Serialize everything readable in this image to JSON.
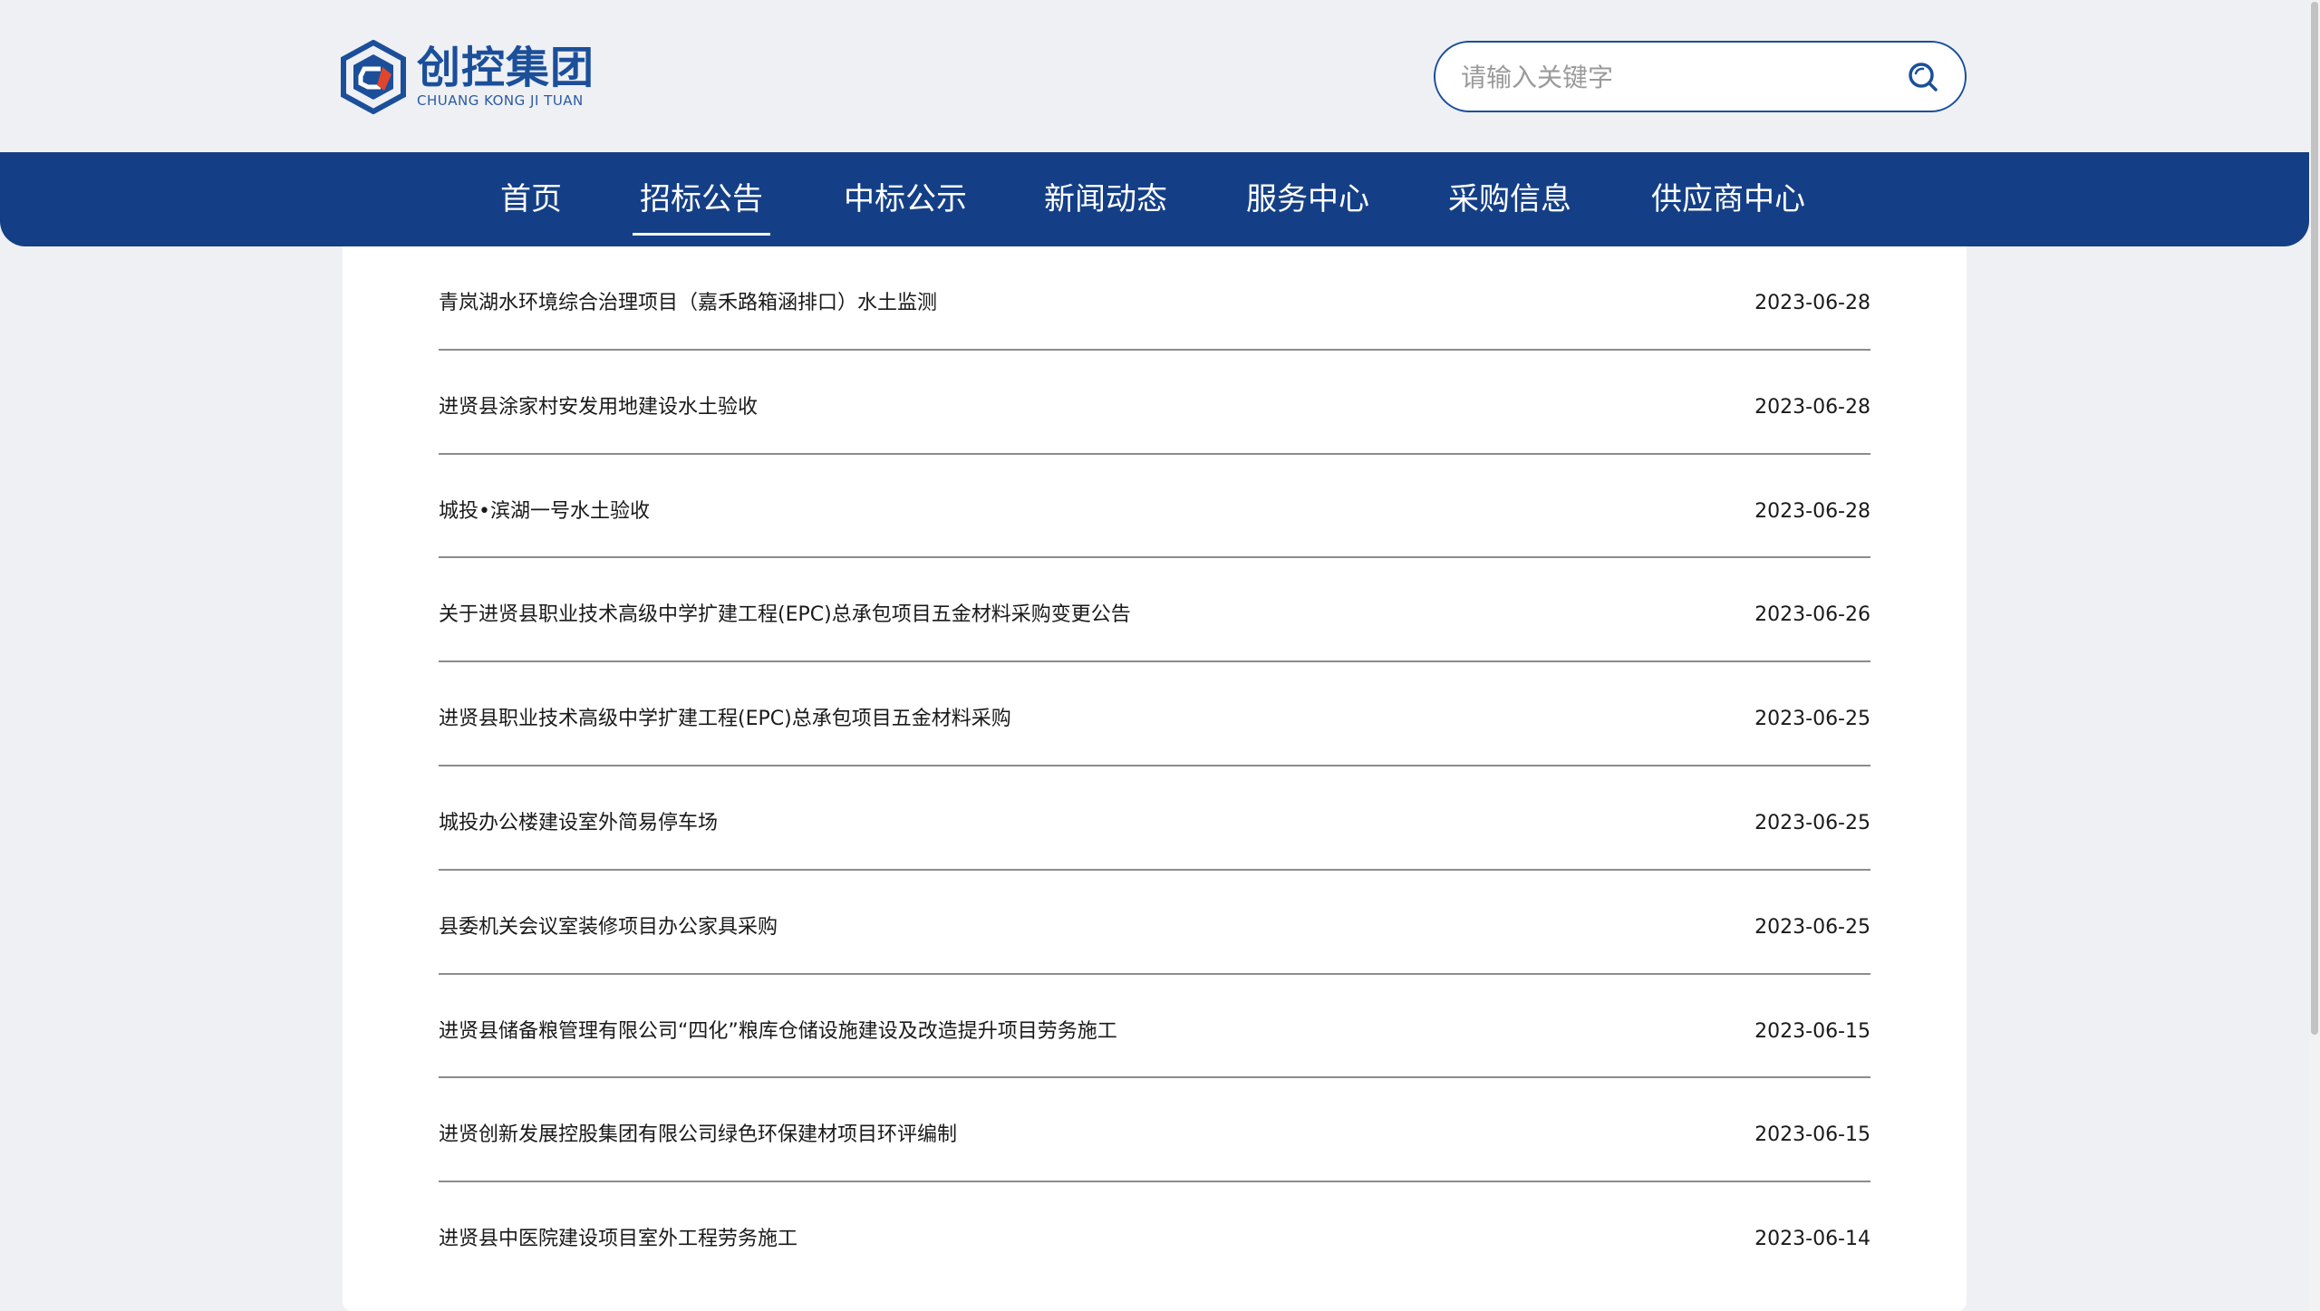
{
  "brand": {
    "name": "创控集团",
    "subtitle": "CHUANG KONG JI TUAN",
    "color": "#1b4f9a",
    "accent": "#e0462c"
  },
  "search": {
    "placeholder": "请输入关键字",
    "value": "",
    "icon": "search-icon"
  },
  "nav": {
    "items": [
      {
        "label": "首页"
      },
      {
        "label": "招标公告"
      },
      {
        "label": "中标公示"
      },
      {
        "label": "新闻动态"
      },
      {
        "label": "服务中心"
      },
      {
        "label": "采购信息"
      },
      {
        "label": "供应商中心"
      }
    ],
    "active": "招标公告",
    "background": "#143f86"
  },
  "notices": [
    {
      "title": "青岚湖水环境综合治理项目（嘉禾路箱涵排口）水土监测",
      "date": "2023-06-28"
    },
    {
      "title": "进贤县涂家村安发用地建设水土验收",
      "date": "2023-06-28"
    },
    {
      "title": "城投•滨湖一号水土验收",
      "date": "2023-06-28"
    },
    {
      "title": "关于进贤县职业技术高级中学扩建工程(EPC)总承包项目五金材料采购变更公告",
      "date": "2023-06-26"
    },
    {
      "title": "进贤县职业技术高级中学扩建工程(EPC)总承包项目五金材料采购",
      "date": "2023-06-25"
    },
    {
      "title": "城投办公楼建设室外简易停车场",
      "date": "2023-06-25"
    },
    {
      "title": "县委机关会议室装修项目办公家具采购",
      "date": "2023-06-25"
    },
    {
      "title": "进贤县储备粮管理有限公司“四化”粮库仓储设施建设及改造提升项目劳务施工",
      "date": "2023-06-15"
    },
    {
      "title": "进贤创新发展控股集团有限公司绿色环保建材项目环评编制",
      "date": "2023-06-15"
    },
    {
      "title": "进贤县中医院建设项目室外工程劳务施工",
      "date": "2023-06-14"
    }
  ]
}
